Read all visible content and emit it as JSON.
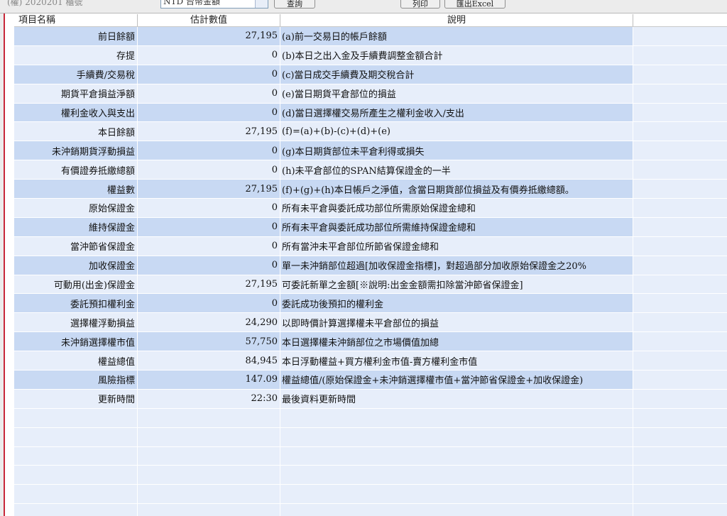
{
  "toolbar": {
    "account_text": "(權) 2020201 櫃號",
    "combo_value": "NTD 台幣金額",
    "button1_label": "查詢",
    "button2_label": "列印",
    "button3_label": "匯出Excel"
  },
  "columns": [
    "項目名稱",
    "估計數值",
    "說明"
  ],
  "rows": [
    {
      "name": "前日餘額",
      "value": "27,195",
      "desc": "(a)前一交易日的帳戶餘額"
    },
    {
      "name": "存提",
      "value": "0",
      "desc": "(b)本日之出入金及手續費調整金額合計"
    },
    {
      "name": "手續費/交易稅",
      "value": "0",
      "desc": "(c)當日成交手續費及期交稅合計"
    },
    {
      "name": "期貨平倉損益淨額",
      "value": "0",
      "desc": "(e)當日期貨平倉部位的損益"
    },
    {
      "name": "權利金收入與支出",
      "value": "0",
      "desc": "(d)當日選擇權交易所產生之權利金收入/支出"
    },
    {
      "name": "本日餘額",
      "value": "27,195",
      "desc": "(f)=(a)+(b)-(c)+(d)+(e)"
    },
    {
      "name": "未沖銷期貨浮動損益",
      "value": "0",
      "desc": "(g)本日期貨部位未平倉利得或損失"
    },
    {
      "name": "有價證券抵繳總額",
      "value": "0",
      "desc": "(h)未平倉部位的SPAN結算保證金的一半"
    },
    {
      "name": "權益數",
      "value": "27,195",
      "desc": "(f)+(g)+(h)本日帳戶之淨值，含當日期貨部位損益及有價券抵繳總額。"
    },
    {
      "name": "原始保證金",
      "value": "0",
      "desc": "所有未平倉與委託成功部位所需原始保證金總和"
    },
    {
      "name": "維持保證金",
      "value": "0",
      "desc": "所有未平倉與委託成功部位所需維持保證金總和"
    },
    {
      "name": "當沖節省保證金",
      "value": "0",
      "desc": "所有當沖未平倉部位所節省保證金總和"
    },
    {
      "name": "加收保證金",
      "value": "0",
      "desc": "單一未沖銷部位超過[加收保證金指標]，對超過部分加收原始保證金之20%"
    },
    {
      "name": "可動用(出金)保證金",
      "value": "27,195",
      "desc": "可委託新單之金額[※說明:出金金額需扣除當沖節省保證金]"
    },
    {
      "name": "委託預扣權利金",
      "value": "0",
      "desc": "委託成功後預扣的權利金"
    },
    {
      "name": "選擇權浮動損益",
      "value": "24,290",
      "desc": "以即時價計算選擇權未平倉部位的損益"
    },
    {
      "name": "未沖銷選擇權市值",
      "value": "57,750",
      "desc": "本日選擇權未沖銷部位之市場價值加總"
    },
    {
      "name": "權益總值",
      "value": "84,945",
      "desc": "本日浮動權益+買方權利金市值-賣方權利金市值"
    },
    {
      "name": "風險指標",
      "value": "147.09",
      "desc": "權益總值/(原始保證金+未沖銷選擇權市值+當沖節省保證金+加收保證金)"
    },
    {
      "name": "更新時間",
      "value": "22:30",
      "desc": "最後資料更新時間"
    }
  ],
  "colors": {
    "row_stripe": "#c8d9f3",
    "grid_background": "#e7eefa",
    "window_edge": "#c8283a"
  }
}
